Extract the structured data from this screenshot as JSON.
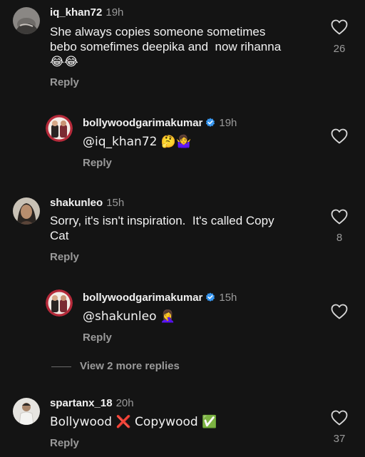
{
  "comments": [
    {
      "username": "iq_khan72",
      "time": "19h",
      "text": "She always copies someone sometimes\nbebo somefimes deepika and  now rihanna\n😂😂",
      "reply": "Reply",
      "likes": "26"
    },
    {
      "username": "bollywoodgarimakumar",
      "time": "19h",
      "verified": true,
      "text": "@iq_khan72 🤔🤷‍♀️",
      "reply": "Reply",
      "likes": ""
    },
    {
      "username": "shakunleo",
      "time": "15h",
      "text": "Sorry, it's isn't inspiration.  It's called Copy\nCat",
      "reply": "Reply",
      "likes": "8"
    },
    {
      "username": "bollywoodgarimakumar",
      "time": "15h",
      "verified": true,
      "text": "@shakunleo 🤦‍♀️",
      "reply": "Reply",
      "likes": ""
    },
    {
      "username": "spartanx_18",
      "time": "20h",
      "text": "Bollywood ❌ Copywood ✅",
      "reply": "Reply",
      "likes": "37"
    }
  ],
  "view_more_replies": "View 2 more replies",
  "colors": {
    "background": "#141414",
    "text": "#f2f2f2",
    "muted": "#9a9a9a",
    "verified": "#3897f0"
  },
  "icons": {
    "like": "heart-outline-icon",
    "verified": "verified-badge-icon"
  }
}
